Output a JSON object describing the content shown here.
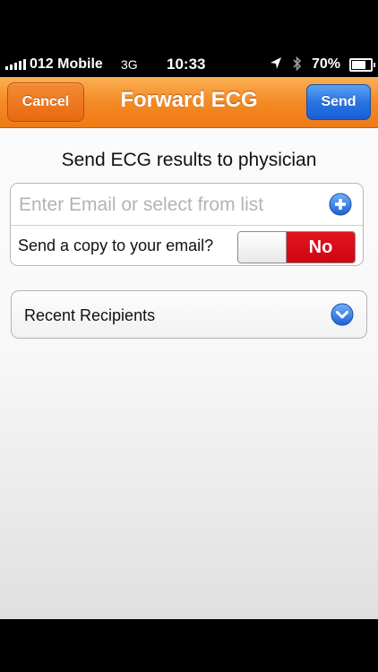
{
  "status_bar": {
    "carrier": "012 Mobile",
    "network": "3G",
    "time": "10:33",
    "battery_percent": "70%",
    "battery_level": 0.7,
    "icons": [
      "signal-icon",
      "location-icon",
      "bluetooth-icon",
      "battery-icon"
    ]
  },
  "nav": {
    "title": "Forward ECG",
    "cancel_label": "Cancel",
    "send_label": "Send"
  },
  "form": {
    "heading": "Send ECG results to physician",
    "email_placeholder": "Enter Email or select from list",
    "add_icon": "plus-circle-icon",
    "copy_label": "Send a copy to your email?",
    "copy_toggle_value": "No"
  },
  "recent": {
    "label": "Recent Recipients",
    "icon": "chevron-down-circle-icon"
  },
  "colors": {
    "nav_orange": "#f48a26",
    "cancel_orange": "#e8690f",
    "send_blue": "#2a74e0",
    "toggle_red": "#cc0612",
    "accent_blue": "#2f7fe6"
  }
}
